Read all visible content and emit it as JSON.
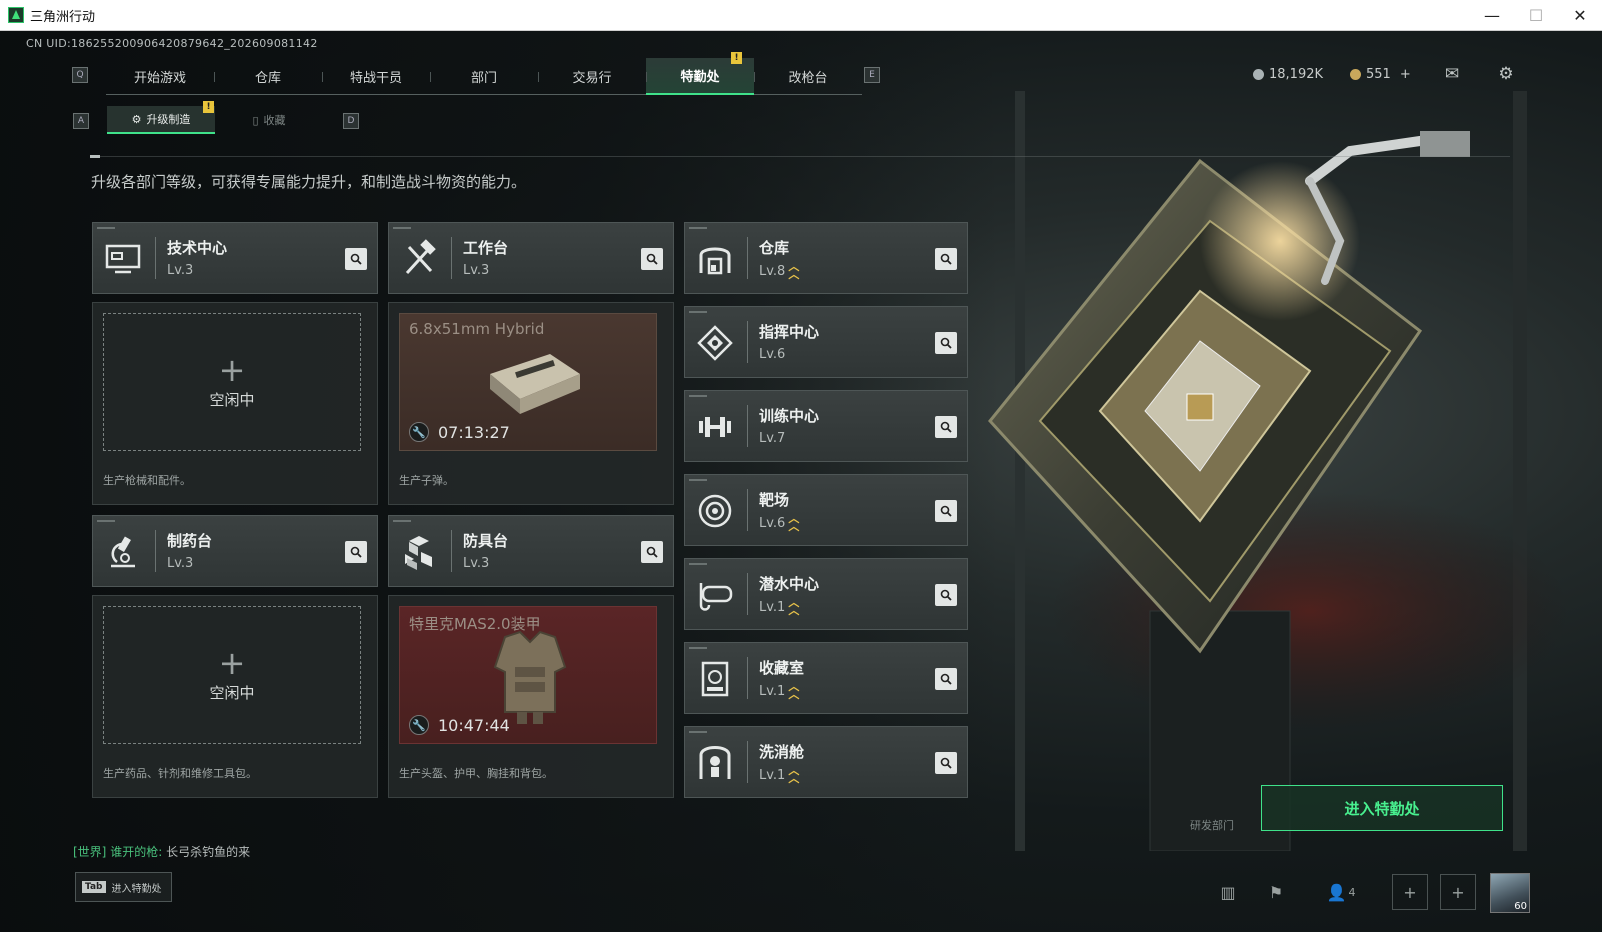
{
  "window": {
    "title": "三角洲行动",
    "minimize": "—",
    "maximize": "☐",
    "close": "✕"
  },
  "uid": "CN UID:18625520090642087964​2_202609081142",
  "nav": {
    "items": [
      {
        "label": "开始游戏"
      },
      {
        "label": "仓库"
      },
      {
        "label": "特战干员"
      },
      {
        "label": "部门"
      },
      {
        "label": "交易行"
      },
      {
        "label": "特勤处"
      },
      {
        "label": "改枪台"
      }
    ],
    "active_index": 5,
    "left_key": "Q",
    "right_key": "E",
    "badge": "!"
  },
  "currency": {
    "tickets": "18,192K",
    "coins": "551",
    "add": "+"
  },
  "subnav": {
    "items": [
      {
        "label": "升级制造"
      },
      {
        "label": "收藏"
      }
    ],
    "left_key": "A",
    "right_key": "D",
    "badge": "!"
  },
  "description": "升级各部门等级，可获得专属能力提升，和制造战斗物资的能力。",
  "workbenches": [
    {
      "name": "技术中心",
      "level": "Lv.3",
      "status": "空闲中",
      "desc": "生产枪械和配件。"
    },
    {
      "name": "工作台",
      "level": "Lv.3",
      "product": "6.8x51mm Hybrid",
      "timer": "07:13:27",
      "desc": "生产子弹。"
    },
    {
      "name": "制药台",
      "level": "Lv.3",
      "status": "空闲中",
      "desc": "生产药品、针剂和维修工具包。"
    },
    {
      "name": "防具台",
      "level": "Lv.3",
      "product": "特里克MAS2.0装甲",
      "timer": "10:47:44",
      "desc": "生产头盔、护甲、胸挂和背包。"
    }
  ],
  "facilities": [
    {
      "name": "仓库",
      "level": "Lv.8",
      "upgradable": true
    },
    {
      "name": "指挥中心",
      "level": "Lv.6",
      "upgradable": false
    },
    {
      "name": "训练中心",
      "level": "Lv.7",
      "upgradable": false
    },
    {
      "name": "靶场",
      "level": "Lv.6",
      "upgradable": true
    },
    {
      "name": "潜水中心",
      "level": "Lv.1",
      "upgradable": true
    },
    {
      "name": "收藏室",
      "level": "Lv.1",
      "upgradable": true
    },
    {
      "name": "洗消舱",
      "level": "Lv.1",
      "upgradable": true
    }
  ],
  "scene_label": "研发部门",
  "cta": "进入特勤处",
  "chat": {
    "channel": "[世界]",
    "sender": "谁开的枪:",
    "message": "长弓杀钓鱼的来"
  },
  "tab_hint": {
    "key": "Tab",
    "label": "进入特勤处"
  },
  "bottom": {
    "friends_count": "4",
    "avatar_level": "60"
  },
  "colors": {
    "accent": "#3fe28a",
    "warning": "#e9c53b",
    "upgrade": "#e7c24a"
  }
}
